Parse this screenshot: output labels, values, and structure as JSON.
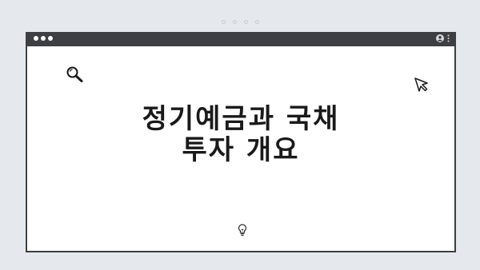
{
  "heading": {
    "line1": "정기예금과 국채",
    "line2": "투자 개요"
  },
  "icons": {
    "search": "search-icon",
    "cursor": "cursor-pointer-icon",
    "bulb": "lightbulb-icon",
    "user": "user-icon",
    "menu": "more-vertical-icon"
  },
  "colors": {
    "background": "#e5e9ee",
    "titlebar": "#3d3f42",
    "window": "#ffffff",
    "text": "#1a1a1a"
  }
}
